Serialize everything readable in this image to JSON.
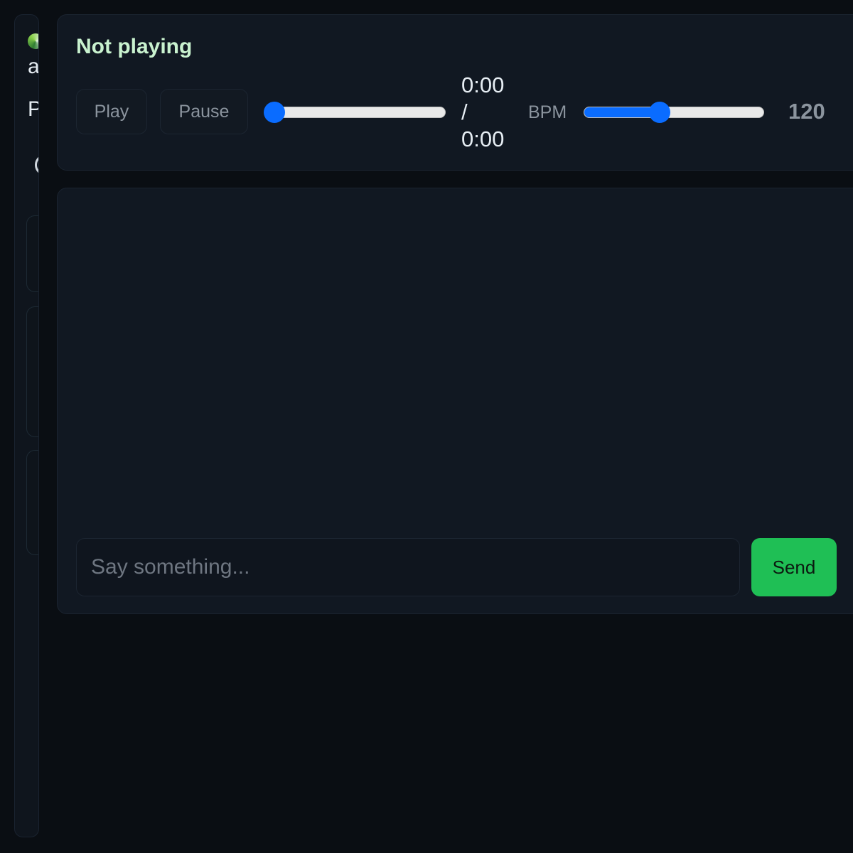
{
  "sidebar": {
    "brand_char": "a",
    "section_char": "P"
  },
  "player": {
    "status": "Not playing",
    "play_label": "Play",
    "pause_label": "Pause",
    "seek_progress": 0,
    "time_current": "0:00",
    "time_separator": "/",
    "time_total": "0:00",
    "bpm_label": "BPM",
    "bpm_value": "120",
    "bpm_slider_fraction": 0.41
  },
  "chat": {
    "input_placeholder": "Say something...",
    "input_value": "",
    "send_label": "Send"
  },
  "colors": {
    "accent": "#0a6cff",
    "send": "#1fbf55",
    "status_text": "#c9f2cf"
  }
}
